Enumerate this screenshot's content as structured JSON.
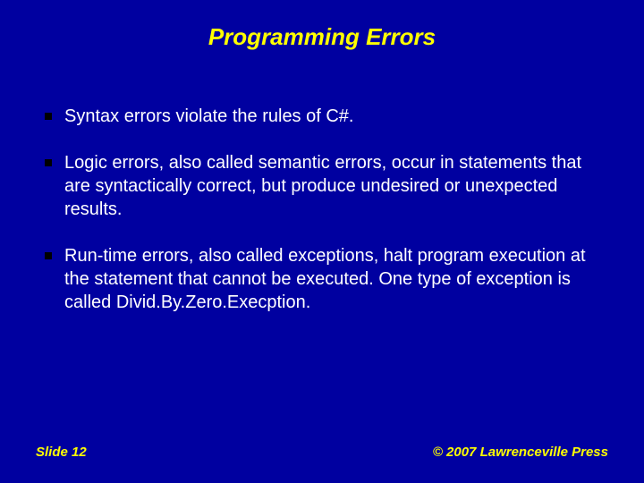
{
  "title": "Programming Errors",
  "bullets": [
    "Syntax errors violate the rules of C#.",
    "Logic errors, also called semantic errors, occur in statements that are syntactically correct, but produce undesired or unexpected results.",
    "Run-time errors, also called exceptions, halt program execution at the statement that cannot be executed. One type of exception is called Divid.By.Zero.Execption."
  ],
  "footer": {
    "left": "Slide 12",
    "right": "© 2007 Lawrenceville Press"
  }
}
